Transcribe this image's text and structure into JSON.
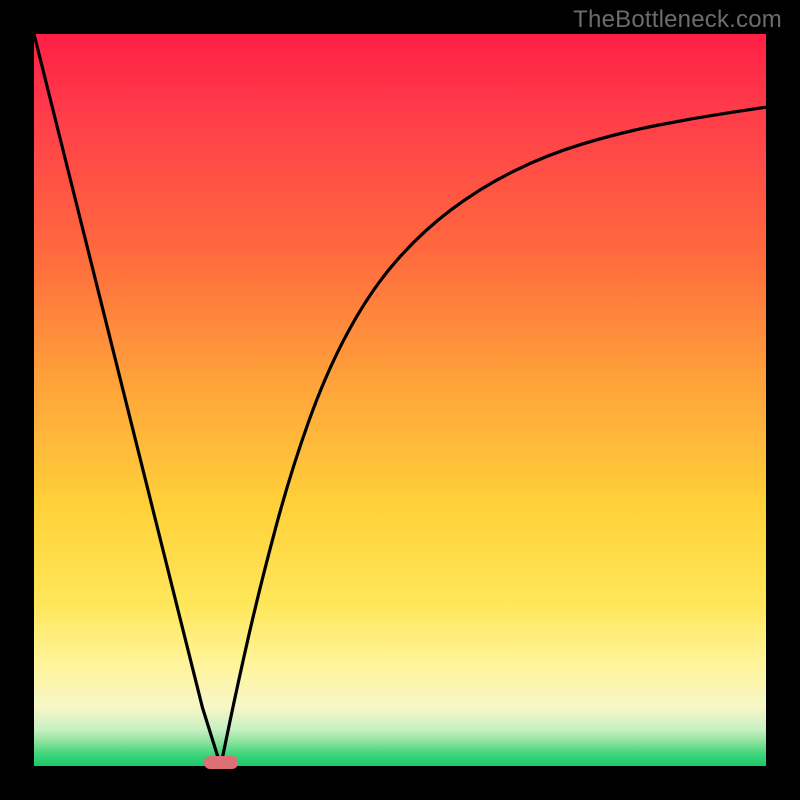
{
  "watermark": "TheBottleneck.com",
  "chart_data": {
    "type": "line",
    "title": "",
    "xlabel": "",
    "ylabel": "",
    "xlim": [
      0,
      100
    ],
    "ylim": [
      0,
      100
    ],
    "background_gradient": {
      "top_color": "#ff1f45",
      "bottom_color": "#1bc96a",
      "meaning": "red=high bottleneck, green=low bottleneck"
    },
    "series": [
      {
        "name": "left-descent",
        "x": [
          0,
          5,
          10,
          15,
          20,
          23,
          25.5
        ],
        "values": [
          100,
          80,
          60,
          40,
          20,
          8,
          0
        ]
      },
      {
        "name": "right-asymptotic-rise",
        "x": [
          25.5,
          28,
          31,
          35,
          40,
          46,
          53,
          61,
          70,
          80,
          90,
          100
        ],
        "values": [
          0,
          12,
          25,
          40,
          54,
          65,
          73,
          79,
          83.5,
          86.5,
          88.5,
          90
        ]
      }
    ],
    "optimum_marker": {
      "x": 25.5,
      "y": 0,
      "color": "#dc7075"
    },
    "colors": {
      "curve": "#000000",
      "frame": "#000000"
    }
  }
}
